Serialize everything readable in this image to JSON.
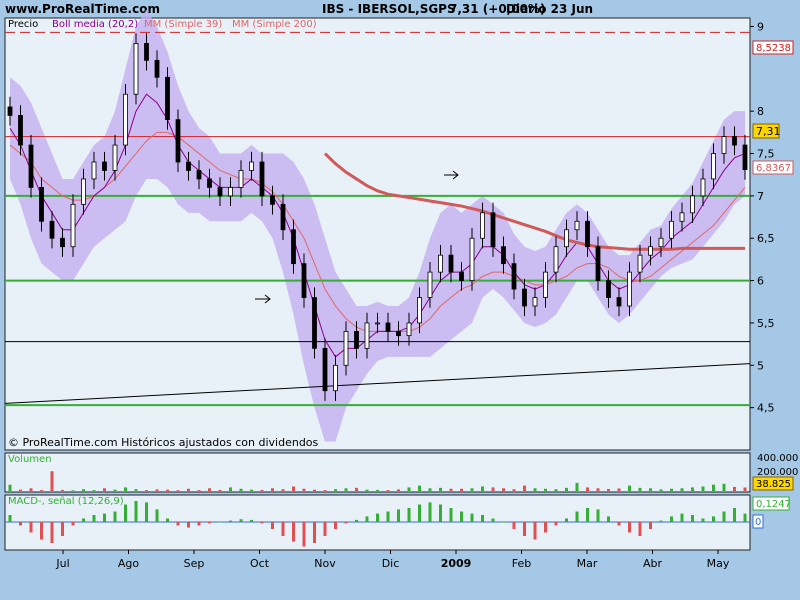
{
  "header": {
    "site": "www.ProRealTime.com",
    "ticker": "IBS - IBERSOL,SGPS",
    "last": "7,31 (+0,00%)",
    "period": "Diario  23 Jun"
  },
  "colors": {
    "background": "#a4c8e6",
    "panel": "#e8f0f8",
    "band": "#c3b0f0",
    "ma20": "#8a008a",
    "ma39": "#e06666",
    "ma200": "#d05a5a",
    "green_line": "#33b033",
    "resistance": "#d02020",
    "volume_up": "#33b033",
    "volume_down": "#e05050",
    "macd_pos": "#33b033",
    "macd_neg": "#e05050",
    "macd_signal": "#3070d0"
  },
  "legend": {
    "price": "Precio",
    "boll": "Boll media (20,2)",
    "ma39": "MM (Simple 39)",
    "ma200": "MM (Simple 200)"
  },
  "footer": "© ProRealTime.com Históricos ajustados con dividendos",
  "volume_panel": {
    "label": "Volumen",
    "tick_200k": "200.000",
    "tick_400k": "400.000",
    "current": "38.825"
  },
  "macd_panel": {
    "label": "MACD-, señal (12,26,9)",
    "value": "0,1247",
    "zero": "0"
  },
  "price_labels": {
    "resistance": "8,5238",
    "last": "7,31",
    "ma200": "6,8367"
  },
  "chart_data": {
    "type": "line",
    "chart": "candlestick",
    "ylim": [
      4.0,
      9.1
    ],
    "y_ticks": [
      "9",
      "8",
      "7,5",
      "7",
      "6,5",
      "6",
      "5,5",
      "5",
      "4,5"
    ],
    "x_tick_labels": [
      "Jul",
      "Ago",
      "Sep",
      "Oct",
      "Nov",
      "Dic",
      "2009",
      "Feb",
      "Mar",
      "Abr",
      "May"
    ],
    "horizontal_lines": [
      {
        "value": 8.93,
        "style": "dashed",
        "color": "#d02020"
      },
      {
        "value": 7.7,
        "style": "solid",
        "color": "#d02020"
      },
      {
        "value": 7.0,
        "style": "solid",
        "color": "#33b033"
      },
      {
        "value": 6.0,
        "style": "solid",
        "color": "#33b033"
      },
      {
        "value": 5.28,
        "style": "solid",
        "color": "#000000"
      },
      {
        "value": 4.53,
        "style": "solid",
        "color": "#33b033"
      }
    ],
    "trendline": {
      "from": [
        "Jun 2008",
        4.55
      ],
      "to": [
        "Jun 2009",
        5.02
      ]
    },
    "close": [
      7.95,
      7.6,
      7.1,
      6.7,
      6.5,
      6.4,
      6.9,
      7.2,
      7.4,
      7.3,
      7.6,
      8.2,
      8.8,
      8.6,
      8.4,
      7.9,
      7.4,
      7.3,
      7.2,
      7.1,
      7.0,
      7.1,
      7.3,
      7.4,
      7.0,
      6.9,
      6.6,
      6.2,
      5.8,
      5.2,
      4.7,
      5.0,
      5.4,
      5.2,
      5.5,
      5.5,
      5.4,
      5.35,
      5.5,
      5.8,
      6.1,
      6.3,
      6.1,
      6.0,
      6.5,
      6.8,
      6.4,
      6.2,
      5.9,
      5.7,
      5.8,
      6.1,
      6.4,
      6.6,
      6.7,
      6.4,
      6.0,
      5.8,
      5.7,
      6.1,
      6.3,
      6.4,
      6.5,
      6.7,
      6.8,
      7.0,
      7.2,
      7.5,
      7.7,
      7.6,
      7.31
    ],
    "ma20": [
      7.8,
      7.6,
      7.3,
      7.0,
      6.8,
      6.6,
      6.6,
      6.8,
      7.0,
      7.1,
      7.3,
      7.6,
      8.0,
      8.2,
      8.1,
      7.9,
      7.6,
      7.4,
      7.3,
      7.2,
      7.1,
      7.1,
      7.1,
      7.2,
      7.1,
      7.0,
      6.8,
      6.5,
      6.1,
      5.7,
      5.3,
      5.1,
      5.2,
      5.2,
      5.3,
      5.4,
      5.4,
      5.4,
      5.45,
      5.6,
      5.8,
      6.0,
      6.1,
      6.1,
      6.2,
      6.4,
      6.4,
      6.3,
      6.1,
      5.95,
      5.9,
      5.95,
      6.1,
      6.3,
      6.45,
      6.4,
      6.2,
      6.0,
      5.9,
      5.95,
      6.1,
      6.25,
      6.35,
      6.5,
      6.6,
      6.7,
      6.9,
      7.1,
      7.3,
      7.45,
      7.5
    ],
    "ma39": [
      7.6,
      7.5,
      7.4,
      7.2,
      7.1,
      7.0,
      6.95,
      6.95,
      7.0,
      7.1,
      7.2,
      7.35,
      7.5,
      7.65,
      7.75,
      7.75,
      7.7,
      7.6,
      7.5,
      7.4,
      7.3,
      7.25,
      7.2,
      7.2,
      7.15,
      7.05,
      6.9,
      6.7,
      6.5,
      6.2,
      5.9,
      5.7,
      5.55,
      5.45,
      5.4,
      5.4,
      5.4,
      5.4,
      5.4,
      5.45,
      5.55,
      5.7,
      5.8,
      5.9,
      5.95,
      6.05,
      6.1,
      6.1,
      6.05,
      6.0,
      5.95,
      5.95,
      6.0,
      6.05,
      6.15,
      6.2,
      6.2,
      6.15,
      6.05,
      6.0,
      6.0,
      6.05,
      6.15,
      6.25,
      6.35,
      6.45,
      6.55,
      6.65,
      6.8,
      6.95,
      7.1
    ],
    "ma200_start_index": 30,
    "ma200": [
      7.5,
      7.38,
      7.28,
      7.2,
      7.12,
      7.06,
      7.02,
      7.0,
      6.98,
      6.96,
      6.94,
      6.92,
      6.9,
      6.88,
      6.85,
      6.82,
      6.78,
      6.74,
      6.7,
      6.66,
      6.62,
      6.58,
      6.53,
      6.48,
      6.45,
      6.42,
      6.4,
      6.39,
      6.38,
      6.37,
      6.37,
      6.37,
      6.37,
      6.37,
      6.38,
      6.38,
      6.38,
      6.38,
      6.38,
      6.38,
      6.38
    ],
    "bollinger_width": [
      0.6,
      0.7,
      0.8,
      0.8,
      0.7,
      0.6,
      0.6,
      0.6,
      0.6,
      0.6,
      0.7,
      0.9,
      1.0,
      1.0,
      0.9,
      0.8,
      0.7,
      0.6,
      0.5,
      0.5,
      0.4,
      0.4,
      0.4,
      0.4,
      0.4,
      0.5,
      0.7,
      0.9,
      1.1,
      1.2,
      1.2,
      1.0,
      0.7,
      0.5,
      0.4,
      0.35,
      0.3,
      0.3,
      0.35,
      0.5,
      0.7,
      0.8,
      0.8,
      0.7,
      0.7,
      0.6,
      0.5,
      0.5,
      0.45,
      0.45,
      0.45,
      0.45,
      0.5,
      0.5,
      0.45,
      0.4,
      0.4,
      0.4,
      0.4,
      0.35,
      0.35,
      0.35,
      0.3,
      0.35,
      0.4,
      0.45,
      0.5,
      0.55,
      0.6,
      0.55,
      0.5
    ],
    "volume": [
      70000,
      15000,
      30000,
      10000,
      220000,
      12000,
      8000,
      20000,
      10000,
      30000,
      15000,
      40000,
      20000,
      10000,
      18000,
      15000,
      9000,
      25000,
      10000,
      30000,
      12000,
      40000,
      25000,
      15000,
      12000,
      30000,
      20000,
      50000,
      25000,
      15000,
      10000,
      20000,
      30000,
      35000,
      15000,
      12000,
      10000,
      18000,
      40000,
      60000,
      30000,
      35000,
      25000,
      25000,
      30000,
      50000,
      40000,
      30000,
      20000,
      60000,
      30000,
      25000,
      20000,
      35000,
      90000,
      40000,
      30000,
      22000,
      28000,
      60000,
      35000,
      30000,
      18000,
      25000,
      30000,
      40000,
      50000,
      70000,
      80000,
      45000,
      38825
    ],
    "macd": [
      0.1,
      -0.05,
      -0.15,
      -0.25,
      -0.3,
      -0.2,
      -0.05,
      0.05,
      0.1,
      0.12,
      0.15,
      0.25,
      0.3,
      0.28,
      0.18,
      0.05,
      -0.05,
      -0.08,
      -0.05,
      -0.02,
      0.0,
      0.02,
      0.04,
      0.03,
      -0.02,
      -0.1,
      -0.2,
      -0.28,
      -0.35,
      -0.3,
      -0.2,
      -0.1,
      -0.02,
      0.03,
      0.08,
      0.12,
      0.15,
      0.18,
      0.2,
      0.25,
      0.28,
      0.25,
      0.2,
      0.15,
      0.12,
      0.1,
      0.05,
      0.0,
      -0.1,
      -0.2,
      -0.25,
      -0.15,
      -0.05,
      0.05,
      0.15,
      0.2,
      0.18,
      0.08,
      -0.05,
      -0.15,
      -0.2,
      -0.1,
      0.02,
      0.08,
      0.12,
      0.1,
      0.05,
      0.08,
      0.15,
      0.2,
      0.12
    ]
  }
}
